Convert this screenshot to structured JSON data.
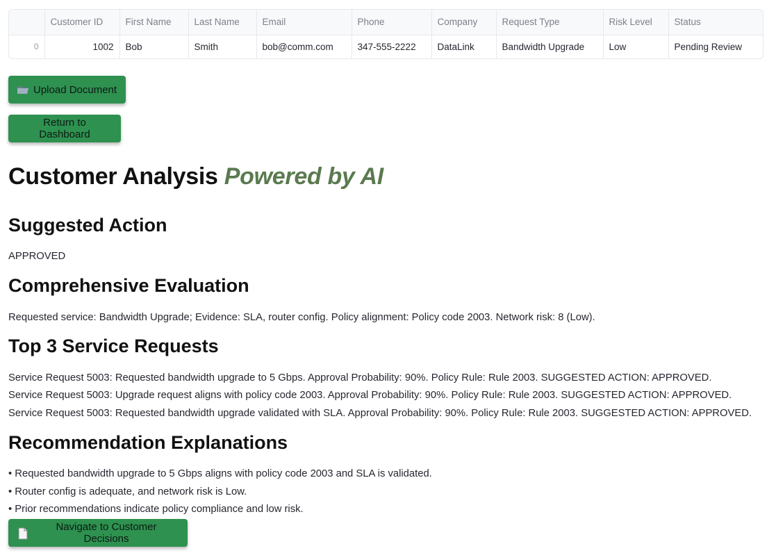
{
  "table": {
    "columns": [
      "",
      "Customer ID",
      "First Name",
      "Last Name",
      "Email",
      "Phone",
      "Company",
      "Request Type",
      "Risk Level",
      "Status"
    ],
    "row": [
      "0",
      "1002",
      "Bob",
      "Smith",
      "bob@comm.com",
      "347-555-2222",
      "DataLink",
      "Bandwidth Upgrade",
      "Low",
      "Pending Review"
    ]
  },
  "buttons": {
    "upload_label": "Upload Document",
    "upload_icon": "folder-icon",
    "return_label": "Return to Dashboard",
    "navigate_label": "Navigate to Customer Decisions",
    "navigate_icon": "document-icon",
    "color": "#2e9150"
  },
  "analysis": {
    "title_main": "Customer Analysis",
    "title_accent": "Powered by AI",
    "accent_color": "#5a7a4f"
  },
  "suggested_action": {
    "heading": "Suggested Action",
    "value": "APPROVED"
  },
  "evaluation": {
    "heading": "Comprehensive Evaluation",
    "text": "Requested service: Bandwidth Upgrade; Evidence: SLA, router config. Policy alignment: Policy code 2003. Network risk: 8 (Low)."
  },
  "service_requests": {
    "heading": "Top 3 Service Requests",
    "items": [
      "Service Request 5003: Requested bandwidth upgrade to 5 Gbps. Approval Probability: 90%. Policy Rule: Rule 2003. SUGGESTED ACTION: APPROVED.",
      "Service Request 5003: Upgrade request aligns with policy code 2003. Approval Probability: 90%. Policy Rule: Rule 2003. SUGGESTED ACTION: APPROVED.",
      "Service Request 5003: Requested bandwidth upgrade validated with SLA. Approval Probability: 90%. Policy Rule: Rule 2003. SUGGESTED ACTION: APPROVED."
    ]
  },
  "explanations": {
    "heading": "Recommendation Explanations",
    "items": [
      "• Requested bandwidth upgrade to 5 Gbps aligns with policy code 2003 and SLA is validated.",
      "• Router config is adequate, and network risk is Low.",
      "• Prior recommendations indicate policy compliance and low risk."
    ]
  }
}
